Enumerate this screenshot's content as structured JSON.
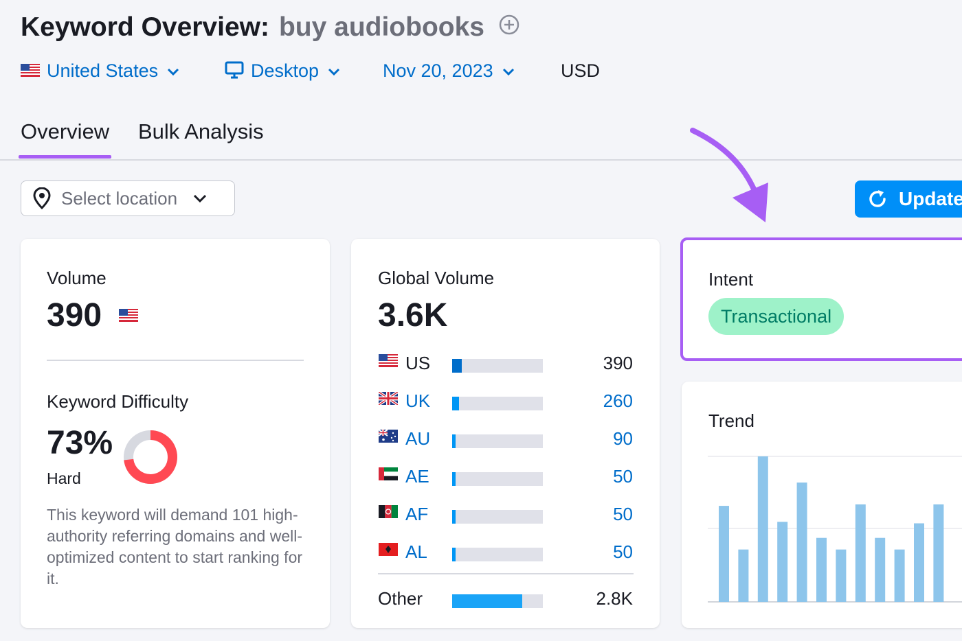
{
  "header": {
    "title": "Keyword Overview:",
    "keyword": "buy audiobooks",
    "filters": {
      "country": "United States",
      "device": "Desktop",
      "date": "Nov 20, 2023",
      "currency": "USD"
    }
  },
  "tabs": [
    {
      "label": "Overview",
      "active": true
    },
    {
      "label": "Bulk Analysis",
      "active": false
    }
  ],
  "location_select": {
    "placeholder": "Select location"
  },
  "update_button": {
    "label": "Update"
  },
  "volume_card": {
    "label": "Volume",
    "value": "390",
    "kd_label": "Keyword Difficulty",
    "kd_value": "73%",
    "kd_level": "Hard",
    "kd_percent": 73,
    "description": "This keyword will demand 101 high-authority referring domains and well-optimized content to start ranking for it."
  },
  "global_volume_card": {
    "label": "Global Volume",
    "value": "3.6K",
    "countries": [
      {
        "code": "US",
        "value": "390",
        "share": 0.108,
        "value_color": "#191b23"
      },
      {
        "code": "UK",
        "value": "260",
        "share": 0.072
      },
      {
        "code": "AU",
        "value": "90",
        "share": 0.025
      },
      {
        "code": "AE",
        "value": "50",
        "share": 0.014
      },
      {
        "code": "AF",
        "value": "50",
        "share": 0.014
      },
      {
        "code": "AL",
        "value": "50",
        "share": 0.014
      }
    ],
    "other": {
      "label": "Other",
      "value": "2.8K",
      "share": 0.77
    }
  },
  "intent_card": {
    "label": "Intent",
    "badge": "Transactional"
  },
  "trend_card": {
    "label": "Trend",
    "bars": [
      0.66,
      0.36,
      1.0,
      0.55,
      0.82,
      0.44,
      0.36,
      0.67,
      0.44,
      0.36,
      0.54,
      0.67
    ]
  },
  "colors": {
    "accent_purple": "#a75ef4",
    "link_blue": "#006dca",
    "button_blue": "#008ff8",
    "difficulty_red": "#ff4953",
    "intent_green": "#9ef2c9",
    "trend_bar": "#8dc5eb"
  }
}
